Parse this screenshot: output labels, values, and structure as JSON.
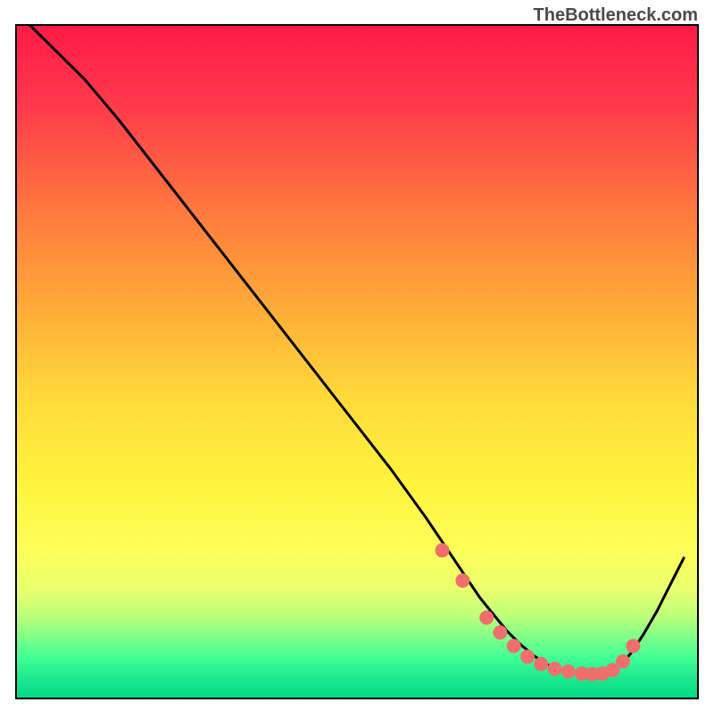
{
  "watermark": "TheBottleneck.com",
  "chart_data": {
    "type": "line",
    "title": "",
    "xlabel": "",
    "ylabel": "",
    "xlim": [
      0,
      100
    ],
    "ylim": [
      0,
      100
    ],
    "background_gradient": {
      "stops": [
        {
          "offset": 0,
          "color": "#ff1744"
        },
        {
          "offset": 15,
          "color": "#ff3d4a"
        },
        {
          "offset": 35,
          "color": "#ff8c3a"
        },
        {
          "offset": 50,
          "color": "#ffc93c"
        },
        {
          "offset": 65,
          "color": "#fff23a"
        },
        {
          "offset": 78,
          "color": "#feff5c"
        },
        {
          "offset": 85,
          "color": "#d4ff7f"
        },
        {
          "offset": 90,
          "color": "#7fff8c"
        },
        {
          "offset": 95,
          "color": "#2eff9e"
        },
        {
          "offset": 100,
          "color": "#00e58a"
        }
      ]
    },
    "series": [
      {
        "name": "bottleneck-curve",
        "type": "line",
        "color": "#000000",
        "x": [
          2,
          5,
          10,
          15,
          20,
          25,
          30,
          35,
          40,
          45,
          50,
          55,
          60,
          62,
          64,
          66,
          68,
          70,
          72,
          74,
          76,
          78,
          80,
          82,
          84,
          86,
          88,
          90,
          92,
          94,
          96,
          98
        ],
        "y": [
          100,
          97,
          92,
          86,
          79.5,
          73,
          66.5,
          60,
          53.5,
          47,
          40.5,
          34,
          27,
          24,
          21,
          18,
          15,
          12.5,
          10,
          8,
          6.3,
          5,
          4.2,
          3.8,
          3.6,
          3.7,
          4.5,
          6.5,
          9.5,
          13,
          17,
          21
        ]
      },
      {
        "name": "optimal-points",
        "type": "scatter",
        "color": "#ef6f6c",
        "x": [
          62.5,
          65.5,
          69,
          71,
          73,
          75,
          77,
          79,
          81,
          83,
          84.5,
          86,
          87.5,
          89,
          90.5
        ],
        "y": [
          22,
          17.5,
          12,
          9.8,
          7.8,
          6.2,
          5.1,
          4.4,
          4.0,
          3.7,
          3.6,
          3.7,
          4.2,
          5.5,
          7.8
        ]
      }
    ]
  }
}
